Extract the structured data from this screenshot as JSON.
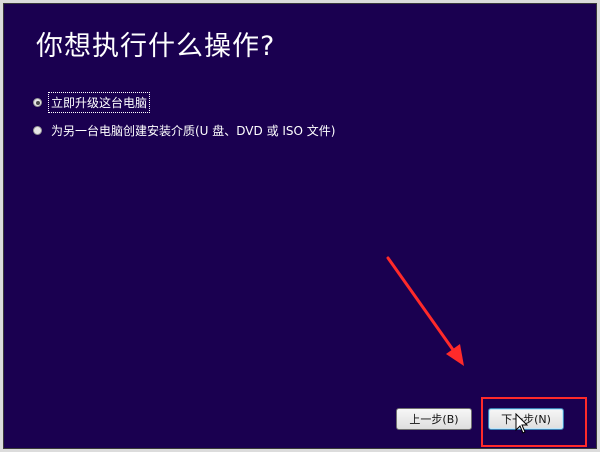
{
  "dialog": {
    "title": "你想执行什么操作?",
    "options": [
      {
        "label": "立即升级这台电脑",
        "selected": true
      },
      {
        "label": "为另一台电脑创建安装介质(U 盘、DVD 或 ISO 文件)",
        "selected": false
      }
    ],
    "buttons": {
      "back_label": "上一步(B)",
      "next_label": "下一步(N)"
    }
  },
  "colors": {
    "background": "#1a0050",
    "annotation": "#ff2a2a"
  }
}
